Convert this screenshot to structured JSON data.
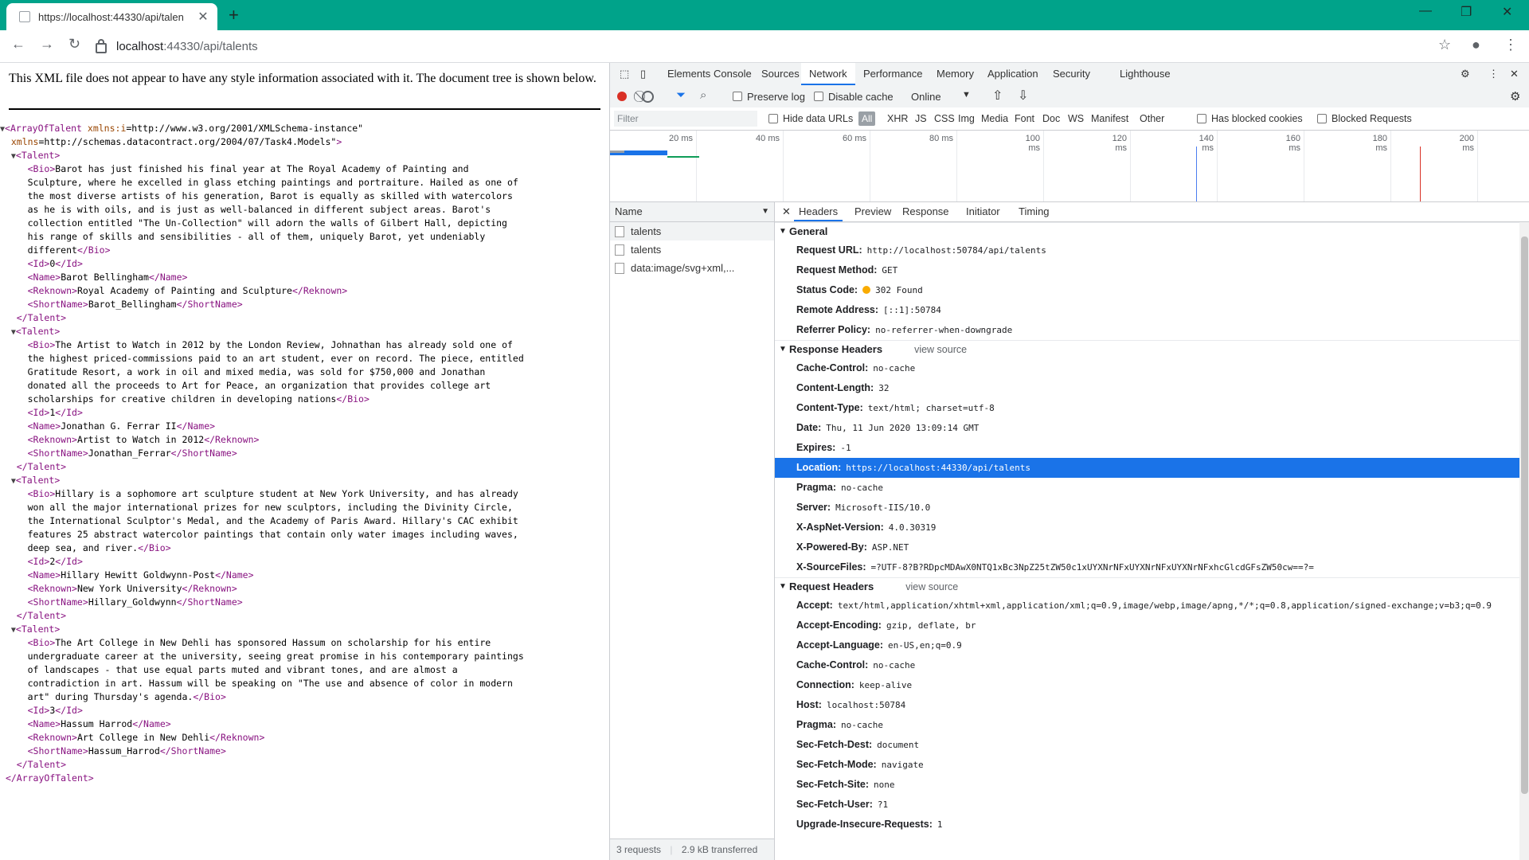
{
  "browser": {
    "tab_title": "https://localhost:44330/api/talen",
    "url_host": "localhost",
    "url_path": ":44330/api/talents"
  },
  "xml": {
    "note": "This XML file does not appear to have any style information associated with it. The document tree is shown below.",
    "lines": [
      {
        "t": "root_open",
        "text": "▼<ArrayOfTalent xmlns:i=\"http://www.w3.org/2001/XMLSchema-instance\""
      },
      {
        "t": "root_attr",
        "text": "  xmlns=\"http://schemas.datacontract.org/2004/07/Task4.Models\">"
      },
      {
        "t": "open",
        "text": "  ▼<Talent>"
      },
      {
        "t": "line",
        "text": "     <Bio>Barot has just finished his final year at The Royal Academy of Painting and"
      },
      {
        "t": "line",
        "text": "     Sculpture, where he excelled in glass etching paintings and portraiture. Hailed as one of"
      },
      {
        "t": "line",
        "text": "     the most diverse artists of his generation, Barot is equally as skilled with watercolors"
      },
      {
        "t": "line",
        "text": "     as he is with oils, and is just as well-balanced in different subject areas. Barot's"
      },
      {
        "t": "line",
        "text": "     collection entitled \"The Un-Collection\" will adorn the walls of Gilbert Hall, depicting"
      },
      {
        "t": "line",
        "text": "     his range of skills and sensibilities - all of them, uniquely Barot, yet undeniably"
      },
      {
        "t": "line",
        "text": "     different</Bio>"
      },
      {
        "t": "line",
        "text": "     <Id>0</Id>"
      },
      {
        "t": "line",
        "text": "     <Name>Barot Bellingham</Name>"
      },
      {
        "t": "line",
        "text": "     <Reknown>Royal Academy of Painting and Sculpture</Reknown>"
      },
      {
        "t": "line",
        "text": "     <ShortName>Barot_Bellingham</ShortName>"
      },
      {
        "t": "close",
        "text": "   </Talent>"
      },
      {
        "t": "open",
        "text": "  ▼<Talent>"
      },
      {
        "t": "line",
        "text": "     <Bio>The Artist to Watch in 2012 by the London Review, Johnathan has already sold one of"
      },
      {
        "t": "line",
        "text": "     the highest priced-commissions paid to an art student, ever on record. The piece, entitled"
      },
      {
        "t": "line",
        "text": "     Gratitude Resort, a work in oil and mixed media, was sold for $750,000 and Jonathan"
      },
      {
        "t": "line",
        "text": "     donated all the proceeds to Art for Peace, an organization that provides college art"
      },
      {
        "t": "line",
        "text": "     scholarships for creative children in developing nations</Bio>"
      },
      {
        "t": "line",
        "text": "     <Id>1</Id>"
      },
      {
        "t": "line",
        "text": "     <Name>Jonathan G. Ferrar II</Name>"
      },
      {
        "t": "line",
        "text": "     <Reknown>Artist to Watch in 2012</Reknown>"
      },
      {
        "t": "line",
        "text": "     <ShortName>Jonathan_Ferrar</ShortName>"
      },
      {
        "t": "close",
        "text": "   </Talent>"
      },
      {
        "t": "open",
        "text": "  ▼<Talent>"
      },
      {
        "t": "line",
        "text": "     <Bio>Hillary is a sophomore art sculpture student at New York University, and has already"
      },
      {
        "t": "line",
        "text": "     won all the major international prizes for new sculptors, including the Divinity Circle,"
      },
      {
        "t": "line",
        "text": "     the International Sculptor's Medal, and the Academy of Paris Award. Hillary's CAC exhibit"
      },
      {
        "t": "line",
        "text": "     features 25 abstract watercolor paintings that contain only water images including waves,"
      },
      {
        "t": "line",
        "text": "     deep sea, and river.</Bio>"
      },
      {
        "t": "line",
        "text": "     <Id>2</Id>"
      },
      {
        "t": "line",
        "text": "     <Name>Hillary Hewitt Goldwynn-Post</Name>"
      },
      {
        "t": "line",
        "text": "     <Reknown>New York University</Reknown>"
      },
      {
        "t": "line",
        "text": "     <ShortName>Hillary_Goldwynn</ShortName>"
      },
      {
        "t": "close",
        "text": "   </Talent>"
      },
      {
        "t": "open",
        "text": "  ▼<Talent>"
      },
      {
        "t": "line",
        "text": "     <Bio>The Art College in New Dehli has sponsored Hassum on scholarship for his entire"
      },
      {
        "t": "line",
        "text": "     undergraduate career at the university, seeing great promise in his contemporary paintings"
      },
      {
        "t": "line",
        "text": "     of landscapes - that use equal parts muted and vibrant tones, and are almost a"
      },
      {
        "t": "line",
        "text": "     contradiction in art. Hassum will be speaking on \"The use and absence of color in modern"
      },
      {
        "t": "line",
        "text": "     art\" during Thursday's agenda.</Bio>"
      },
      {
        "t": "line",
        "text": "     <Id>3</Id>"
      },
      {
        "t": "line",
        "text": "     <Name>Hassum Harrod</Name>"
      },
      {
        "t": "line",
        "text": "     <Reknown>Art College in New Dehli</Reknown>"
      },
      {
        "t": "line",
        "text": "     <ShortName>Hassum_Harrod</ShortName>"
      },
      {
        "t": "close",
        "text": "   </Talent>"
      },
      {
        "t": "close",
        "text": " </ArrayOfTalent>"
      }
    ]
  },
  "devtools": {
    "tabs": [
      "Elements",
      "Console",
      "Sources",
      "Network",
      "Performance",
      "Memory",
      "Application",
      "Security",
      "Lighthouse"
    ],
    "active_tab": "Network",
    "toolbar": {
      "preserve_log": "Preserve log",
      "disable_cache": "Disable cache",
      "throttle": "Online"
    },
    "filterbar": {
      "placeholder": "Filter",
      "hide_data_urls": "Hide data URLs",
      "all": "All",
      "types": [
        "XHR",
        "JS",
        "CSS",
        "Img",
        "Media",
        "Font",
        "Doc",
        "WS",
        "Manifest",
        "Other"
      ],
      "blocked_cookies": "Has blocked cookies",
      "blocked_requests": "Blocked Requests"
    },
    "overview_ticks": [
      "20 ms",
      "40 ms",
      "60 ms",
      "80 ms",
      "100 ms",
      "120 ms",
      "140 ms",
      "160 ms",
      "180 ms",
      "200 ms"
    ],
    "name_header": "Name",
    "requests": [
      "talents",
      "talents",
      "data:image/svg+xml,..."
    ],
    "summary": {
      "requests": "3 requests",
      "transferred": "2.9 kB transferred"
    },
    "detail_tabs": [
      "Headers",
      "Preview",
      "Response",
      "Initiator",
      "Timing"
    ],
    "general": {
      "title": "General",
      "rows": [
        {
          "k": "Request URL:",
          "v": "http://localhost:50784/api/talents"
        },
        {
          "k": "Request Method:",
          "v": "GET"
        },
        {
          "k": "Status Code:",
          "v": "302 Found"
        },
        {
          "k": "Remote Address:",
          "v": "[::1]:50784"
        },
        {
          "k": "Referrer Policy:",
          "v": "no-referrer-when-downgrade"
        }
      ]
    },
    "response_headers": {
      "title": "Response Headers",
      "view_source": "view source",
      "rows": [
        {
          "k": "Cache-Control:",
          "v": "no-cache"
        },
        {
          "k": "Content-Length:",
          "v": "32"
        },
        {
          "k": "Content-Type:",
          "v": "text/html; charset=utf-8"
        },
        {
          "k": "Date:",
          "v": "Thu, 11 Jun 2020 13:09:14 GMT"
        },
        {
          "k": "Expires:",
          "v": "-1"
        },
        {
          "k": "Location:",
          "v": "https://localhost:44330/api/talents"
        },
        {
          "k": "Pragma:",
          "v": "no-cache"
        },
        {
          "k": "Server:",
          "v": "Microsoft-IIS/10.0"
        },
        {
          "k": "X-AspNet-Version:",
          "v": "4.0.30319"
        },
        {
          "k": "X-Powered-By:",
          "v": "ASP.NET"
        },
        {
          "k": "X-SourceFiles:",
          "v": "=?UTF-8?B?RDpcMDAwX0NTQ1xBc3NpZ25tZW50c1xUYXNrNFxUYXNrNFxUYXNrNFxhcGlcdGFsZW50cw==?="
        }
      ]
    },
    "request_headers": {
      "title": "Request Headers",
      "view_source": "view source",
      "rows": [
        {
          "k": "Accept:",
          "v": "text/html,application/xhtml+xml,application/xml;q=0.9,image/webp,image/apng,*/*;q=0.8,application/signed-exchange;v=b3;q=0.9"
        },
        {
          "k": "Accept-Encoding:",
          "v": "gzip, deflate, br"
        },
        {
          "k": "Accept-Language:",
          "v": "en-US,en;q=0.9"
        },
        {
          "k": "Cache-Control:",
          "v": "no-cache"
        },
        {
          "k": "Connection:",
          "v": "keep-alive"
        },
        {
          "k": "Host:",
          "v": "localhost:50784"
        },
        {
          "k": "Pragma:",
          "v": "no-cache"
        },
        {
          "k": "Sec-Fetch-Dest:",
          "v": "document"
        },
        {
          "k": "Sec-Fetch-Mode:",
          "v": "navigate"
        },
        {
          "k": "Sec-Fetch-Site:",
          "v": "none"
        },
        {
          "k": "Sec-Fetch-User:",
          "v": "?1"
        },
        {
          "k": "Upgrade-Insecure-Requests:",
          "v": "1"
        }
      ]
    }
  }
}
